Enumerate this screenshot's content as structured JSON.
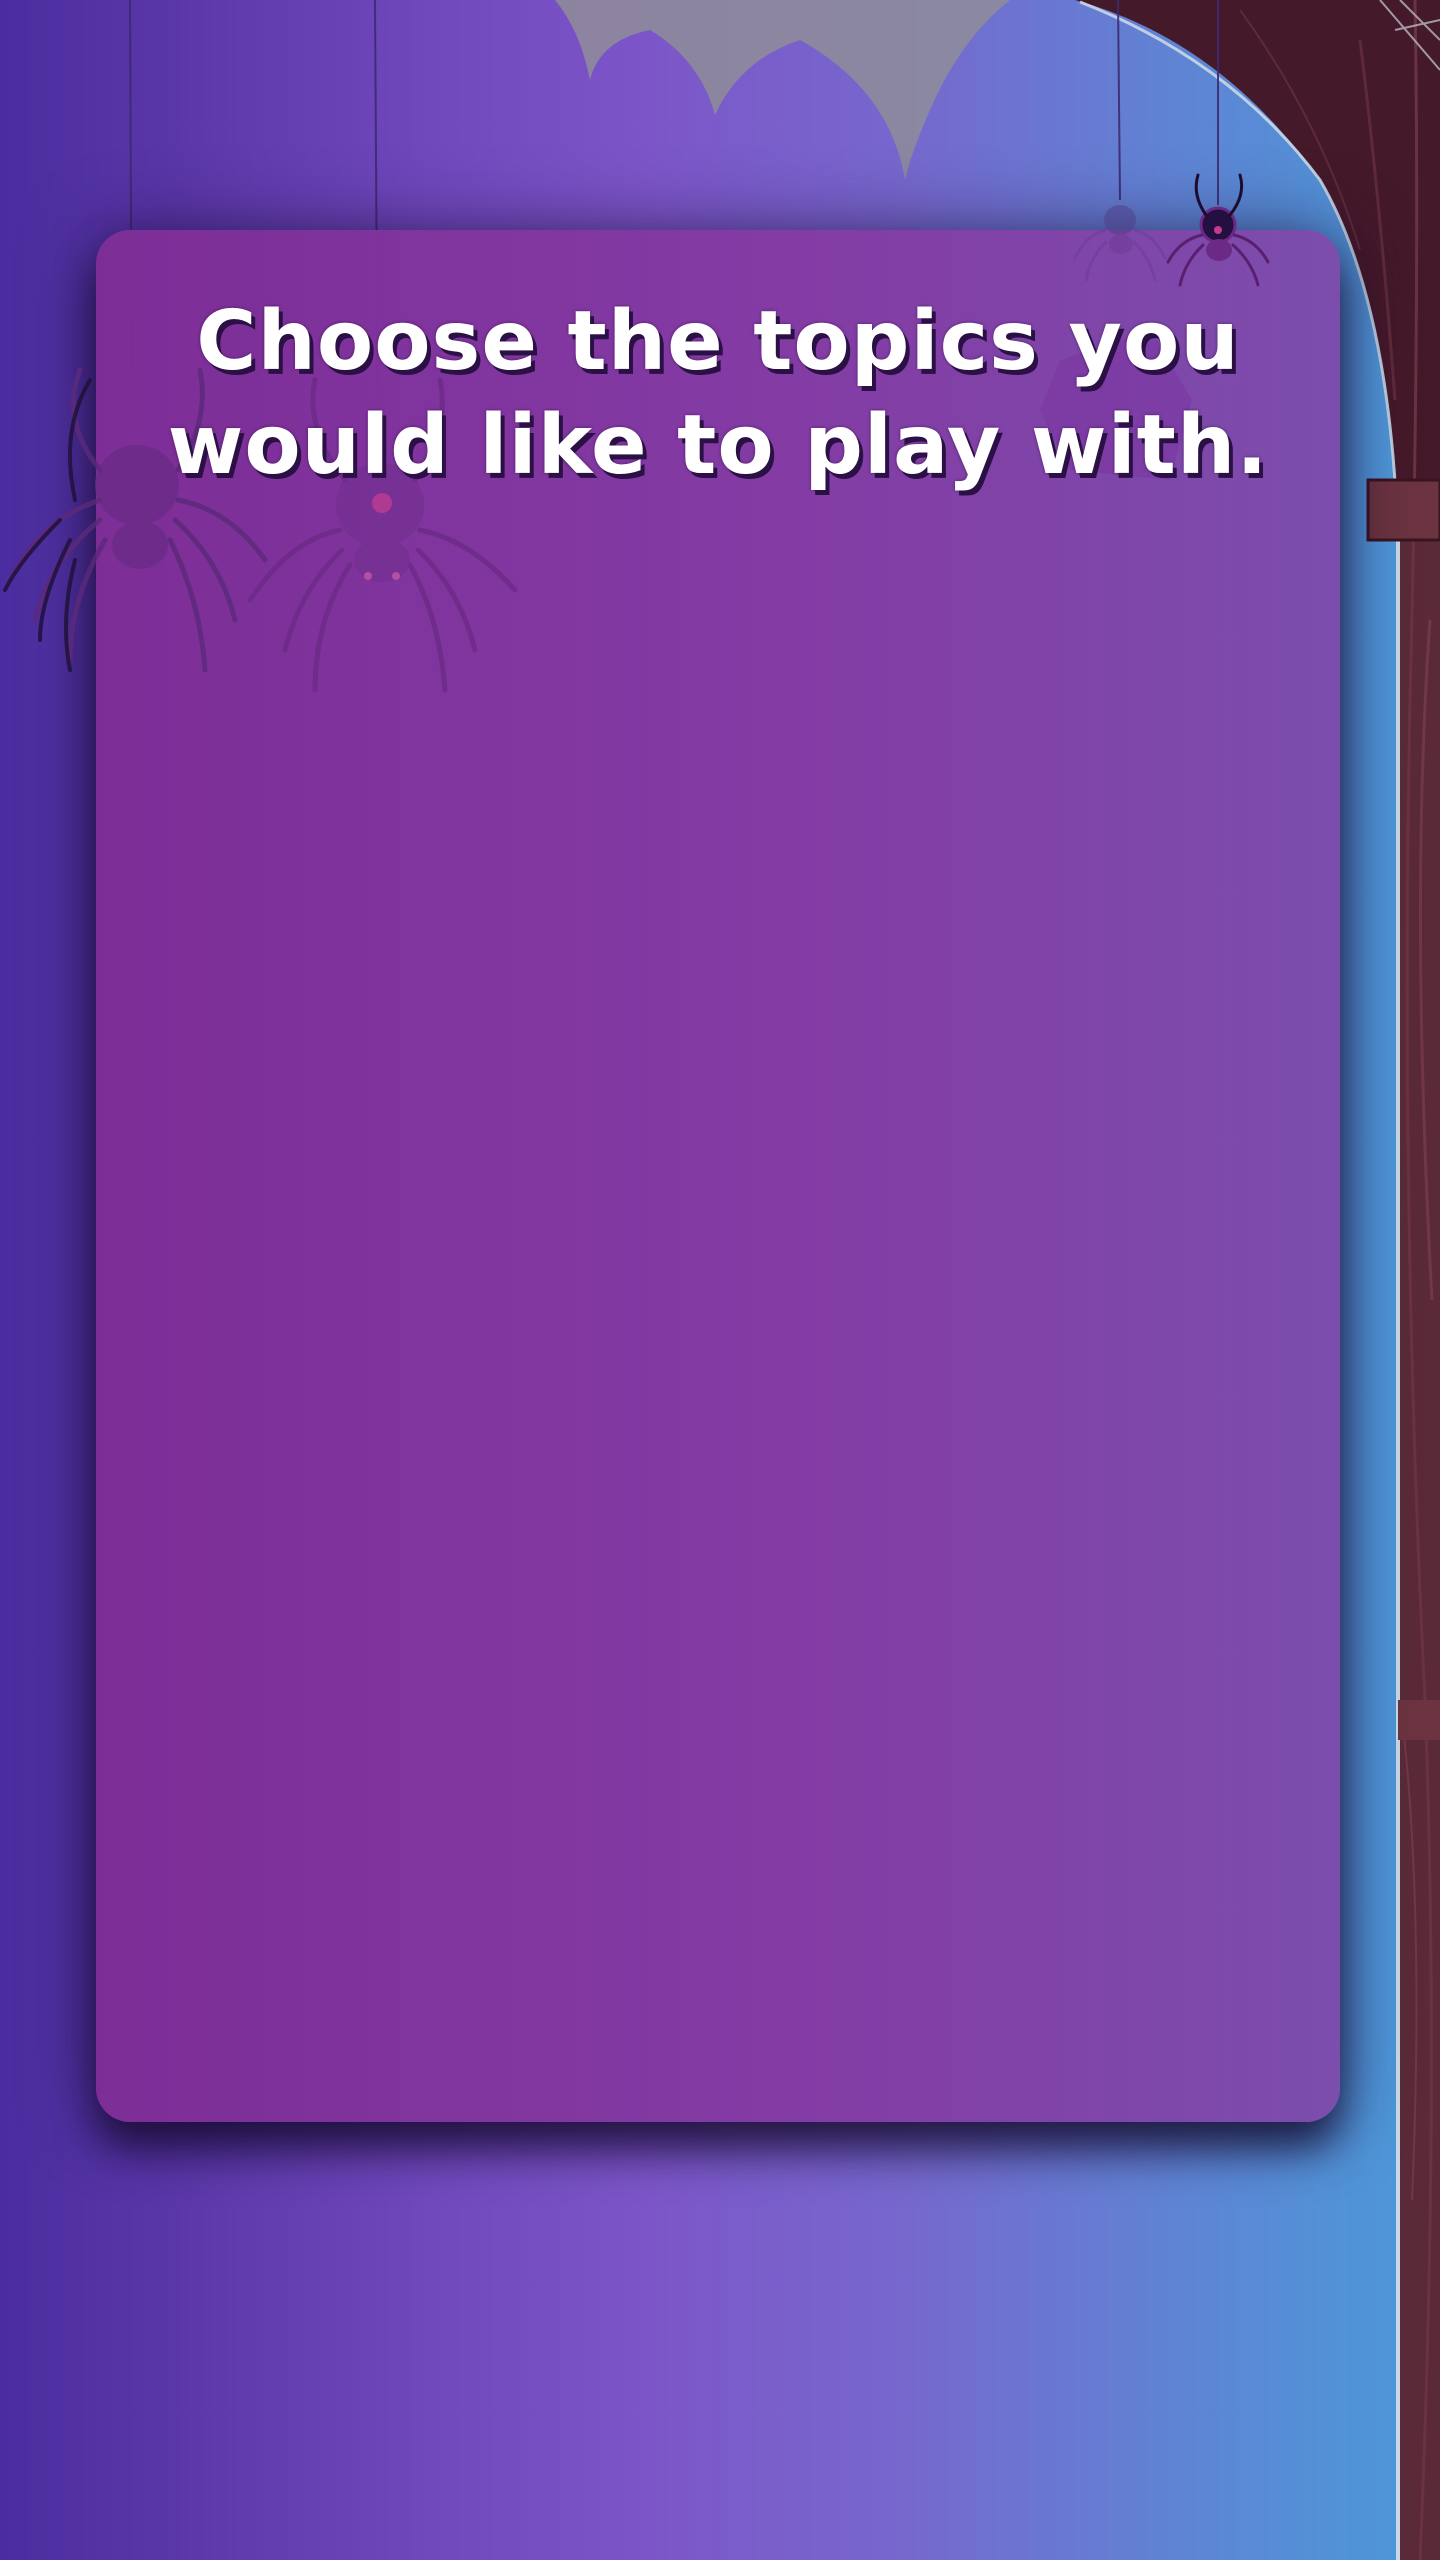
{
  "screen": {
    "title": "Choose the topics you would like to play with."
  },
  "colors": {
    "background_left": "#4b2d9f",
    "background_center": "#7c56c8",
    "background_right": "#4a9ad8",
    "panel": "#7e2d96",
    "title_text": "#ffffff",
    "title_shadow": "#2a1045",
    "wood": "#4a1f2b",
    "cobweb": "#9a9a9a"
  },
  "decorations": [
    "cobweb-top",
    "tree-trunk-right",
    "hanging-spider-left",
    "hanging-spider-center",
    "hanging-spider-top-right",
    "hanging-spider-top-right-faded",
    "sign-plank"
  ]
}
